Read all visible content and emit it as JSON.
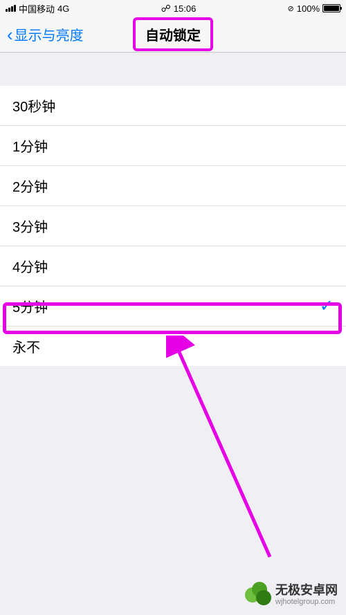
{
  "statusBar": {
    "carrier": "中国移动",
    "network": "4G",
    "time": "15:06",
    "batteryPercent": "100%"
  },
  "nav": {
    "backLabel": "显示与亮度",
    "title": "自动锁定"
  },
  "options": [
    {
      "label": "30秒钟",
      "selected": false
    },
    {
      "label": "1分钟",
      "selected": false
    },
    {
      "label": "2分钟",
      "selected": false
    },
    {
      "label": "3分钟",
      "selected": false
    },
    {
      "label": "4分钟",
      "selected": false
    },
    {
      "label": "5分钟",
      "selected": true
    },
    {
      "label": "永不",
      "selected": false
    }
  ],
  "watermark": {
    "main": "无极安卓网",
    "sub": "wjhotelgroup.com"
  }
}
